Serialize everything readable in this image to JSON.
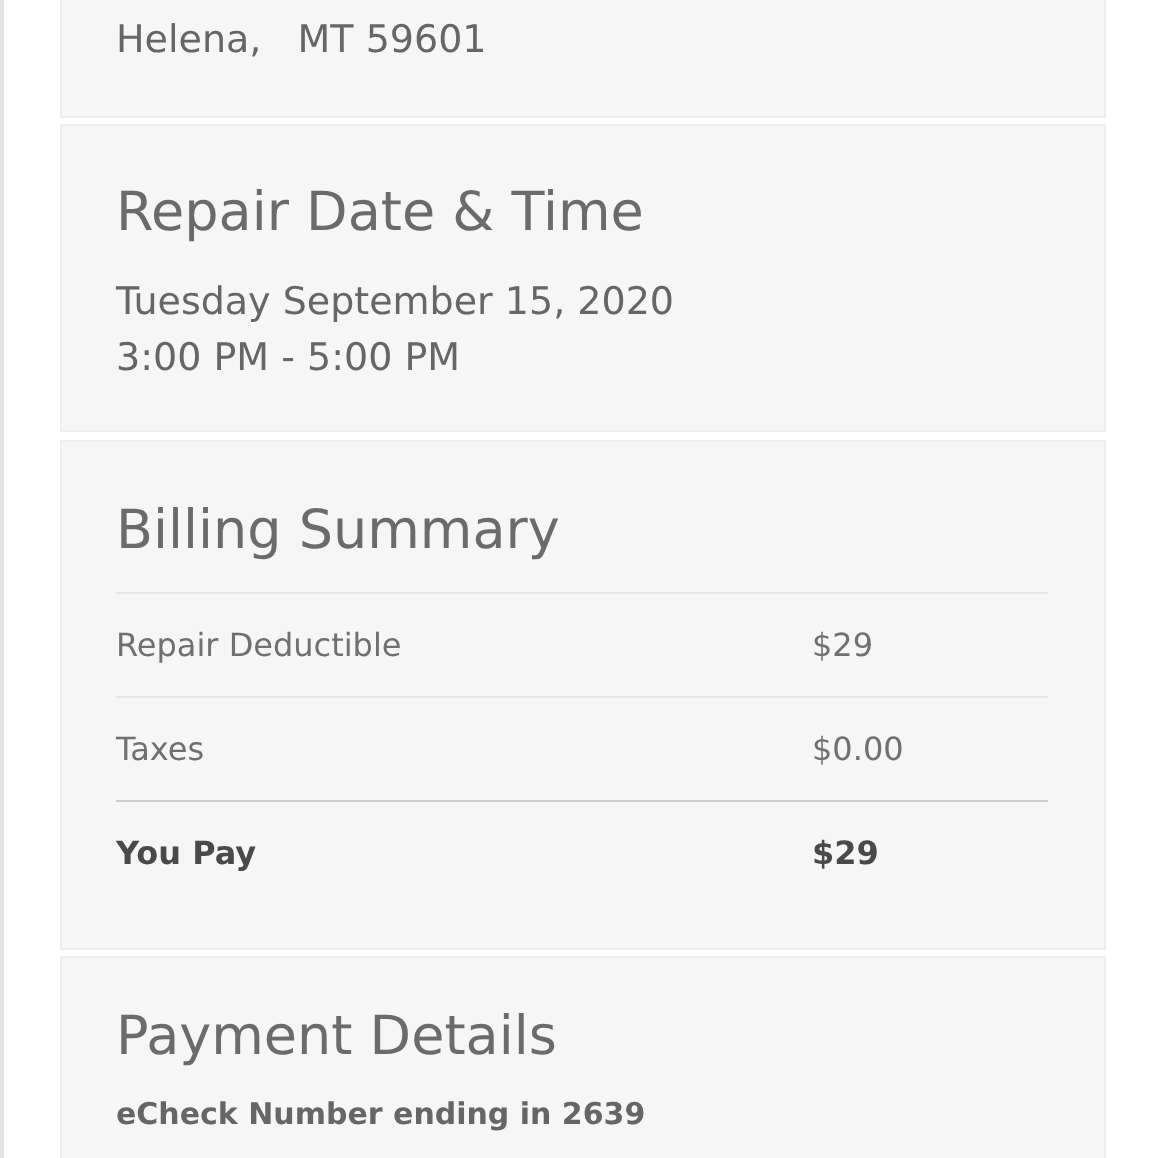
{
  "address": {
    "city_line": "Helena,   MT 59601"
  },
  "repair": {
    "title": "Repair Date & Time",
    "date": "Tuesday September 15, 2020",
    "time": "3:00 PM - 5:00 PM"
  },
  "billing": {
    "title": "Billing Summary",
    "rows": [
      {
        "label": "Repair Deductible",
        "value": "$29",
        "kind": "item"
      },
      {
        "label": "Taxes",
        "value": "$0.00",
        "kind": "item"
      },
      {
        "label": "You Pay",
        "value": "$29",
        "kind": "total"
      }
    ]
  },
  "payment": {
    "title": "Payment Details",
    "method": "eCheck Number ending in 2639"
  }
}
